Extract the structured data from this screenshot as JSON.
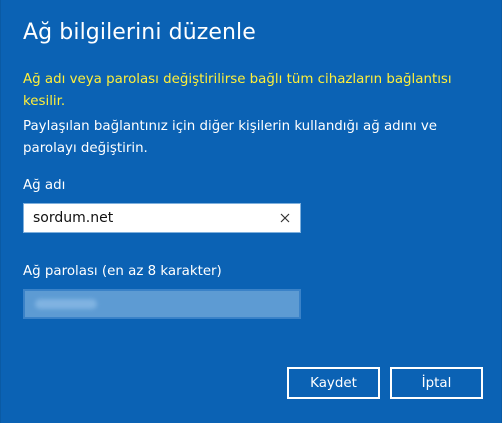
{
  "dialog": {
    "title": "Ağ bilgilerini düzenle",
    "warning": "Ağ adı veya parolası değiştirilirse bağlı tüm cihazların bağlantısı kesilir.",
    "info": "Paylaşılan bağlantınız için diğer kişilerin kullandığı ağ adını ve parolayı değiştirin.",
    "network_name_label": "Ağ adı",
    "network_name_value": "sordum.net",
    "password_label": "Ağ parolası (en az 8 karakter)",
    "save_label": "Kaydet",
    "cancel_label": "İptal"
  },
  "colors": {
    "background": "#0b62b4",
    "warning_text": "#ffef3a",
    "password_field": "#5d9bd3"
  },
  "icons": {
    "clear": "close-icon"
  }
}
